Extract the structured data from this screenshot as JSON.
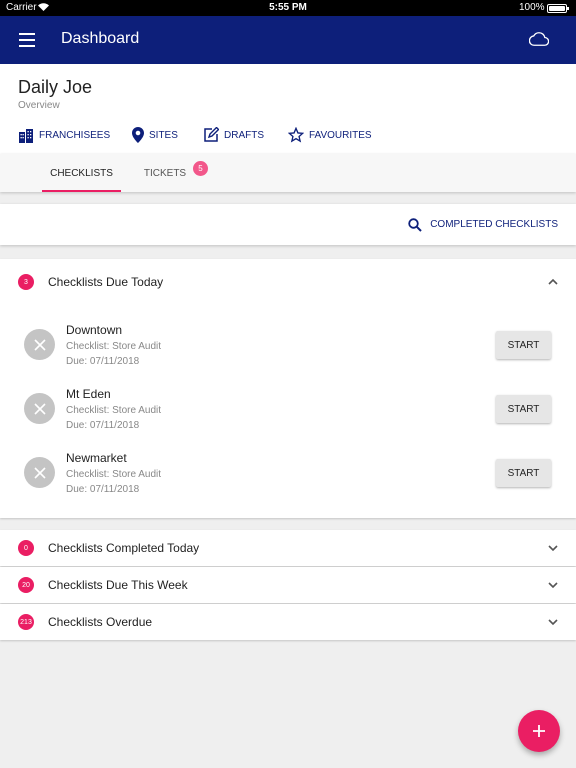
{
  "status_bar": {
    "carrier": "Carrier",
    "time": "5:55 PM",
    "battery": "100%"
  },
  "app_bar": {
    "title": "Dashboard",
    "menu_icon": "menu-icon",
    "cloud_icon": "cloud-icon"
  },
  "header": {
    "name": "Daily Joe",
    "subtitle": "Overview",
    "nav": [
      {
        "label": "FRANCHISEES",
        "icon": "franchisees-icon"
      },
      {
        "label": "SITES",
        "icon": "location-pin-icon"
      },
      {
        "label": "DRAFTS",
        "icon": "edit-icon"
      },
      {
        "label": "FAVOURITES",
        "icon": "star-icon"
      }
    ]
  },
  "tabs": [
    {
      "label": "CHECKLISTS",
      "active": true
    },
    {
      "label": "TICKETS",
      "active": false,
      "badge": "5"
    }
  ],
  "search_action": {
    "label": "COMPLETED CHECKLISTS",
    "icon": "search-icon"
  },
  "due_today": {
    "count": "3",
    "title": "Checklists Due Today",
    "items": [
      {
        "site": "Downtown",
        "checklist": "Checklist: Store Audit",
        "due": "Due: 07/11/2018",
        "button": "START"
      },
      {
        "site": "Mt Eden",
        "checklist": "Checklist: Store Audit",
        "due": "Due: 07/11/2018",
        "button": "START"
      },
      {
        "site": "Newmarket",
        "checklist": "Checklist: Store Audit",
        "due": "Due: 07/11/2018",
        "button": "START"
      }
    ]
  },
  "sections": [
    {
      "count": "0",
      "title": "Checklists Completed Today"
    },
    {
      "count": "20",
      "title": "Checklists Due This Week"
    },
    {
      "count": "213",
      "title": "Checklists Overdue"
    }
  ],
  "colors": {
    "primary": "#0d1f7a",
    "accent": "#ea1e63",
    "badge_light": "#f2578a"
  },
  "fab": {
    "icon": "plus-icon"
  }
}
